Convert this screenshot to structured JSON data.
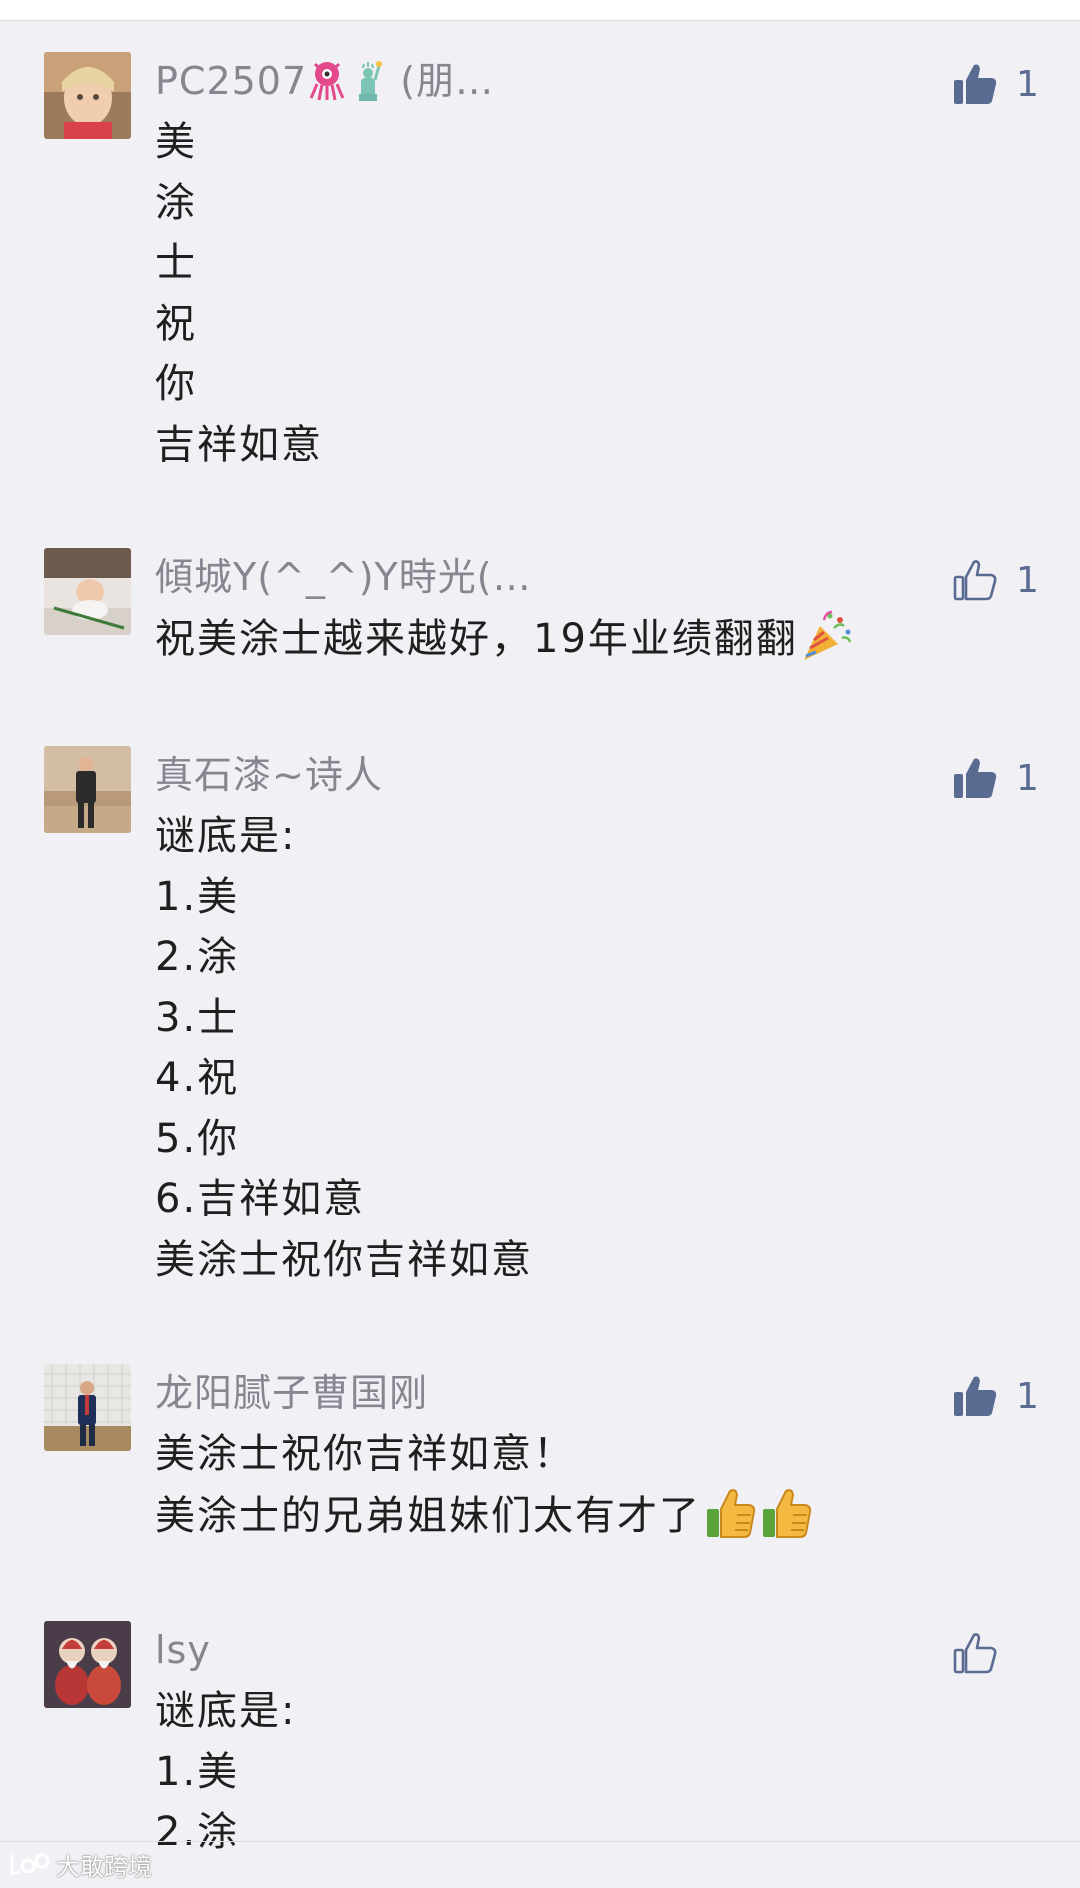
{
  "comments": [
    {
      "nickname": "PC2507",
      "nickname_suffix": "(朋…",
      "nickname_emojis": [
        "octopus-icon",
        "statue-of-liberty-icon"
      ],
      "liked": true,
      "like_count": "1",
      "lines": [
        "美",
        "涂",
        "士",
        "祝",
        "你",
        "吉祥如意"
      ]
    },
    {
      "nickname": "傾城Y(^_^)Y時光(…",
      "liked": false,
      "like_count": "1",
      "lines": [
        "祝美涂士越来越好，19年业绩翻翻"
      ],
      "line_emoji": "party-popper-icon"
    },
    {
      "nickname": "真石漆~诗人",
      "liked": true,
      "like_count": "1",
      "lines": [
        "谜底是:",
        "1.美",
        "2.涂",
        "3.士",
        "4.祝",
        "5.你",
        "6.吉祥如意",
        "美涂士祝你吉祥如意"
      ]
    },
    {
      "nickname": "龙阳腻子曹国刚",
      "liked": true,
      "like_count": "1",
      "lines": [
        "美涂士祝你吉祥如意！",
        "美涂士的兄弟姐妹们太有才了"
      ],
      "line_emoji": "thumbs-up-emoji"
    },
    {
      "nickname": "lsy",
      "liked": false,
      "like_count": "",
      "lines": [
        "谜底是:",
        "1.美",
        "2.涂"
      ]
    }
  ],
  "watermark": "大敢跨境",
  "colors": {
    "background": "#f1f0f4",
    "nickname": "#868590",
    "text": "#1f1f1f",
    "like_accent": "#5a6b91"
  }
}
